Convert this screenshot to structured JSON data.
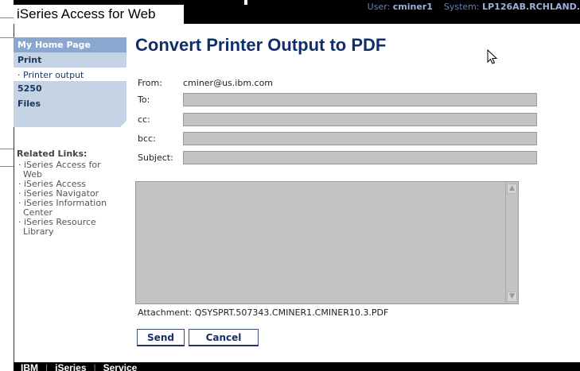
{
  "banner": {
    "title": "iSeries Access for Web",
    "user_label": "User:",
    "user_value": "cminer1",
    "system_label": "System:",
    "system_value": "LP126AB.RCHLAND."
  },
  "nav": {
    "home": "My Home Page",
    "print": "Print",
    "printer_output": "Printer output",
    "n5250": "5250",
    "files": "Files"
  },
  "related": {
    "title": "Related Links:",
    "links": [
      "iSeries Access for Web",
      "iSeries Access",
      "iSeries Navigator",
      "iSeries Information Center",
      "iSeries Resource Library"
    ]
  },
  "page": {
    "title": "Convert Printer Output to PDF"
  },
  "form": {
    "from_label": "From:",
    "from_value": "cminer@us.ibm.com",
    "to_label": "To:",
    "cc_label": "cc:",
    "bcc_label": "bcc:",
    "subject_label": "Subject:",
    "attachment_label": "Attachment:",
    "attachment_value": "QSYSPRT.507343.CMINER1.CMINER10.3.PDF",
    "send_label": "Send",
    "cancel_label": "Cancel"
  },
  "footer": {
    "items": [
      "IBM",
      "iSeries",
      "Service"
    ]
  },
  "icons": {
    "scroll_up": "chevron-up-icon",
    "scroll_down": "chevron-down-icon",
    "cursor": "mouse-pointer-icon"
  }
}
